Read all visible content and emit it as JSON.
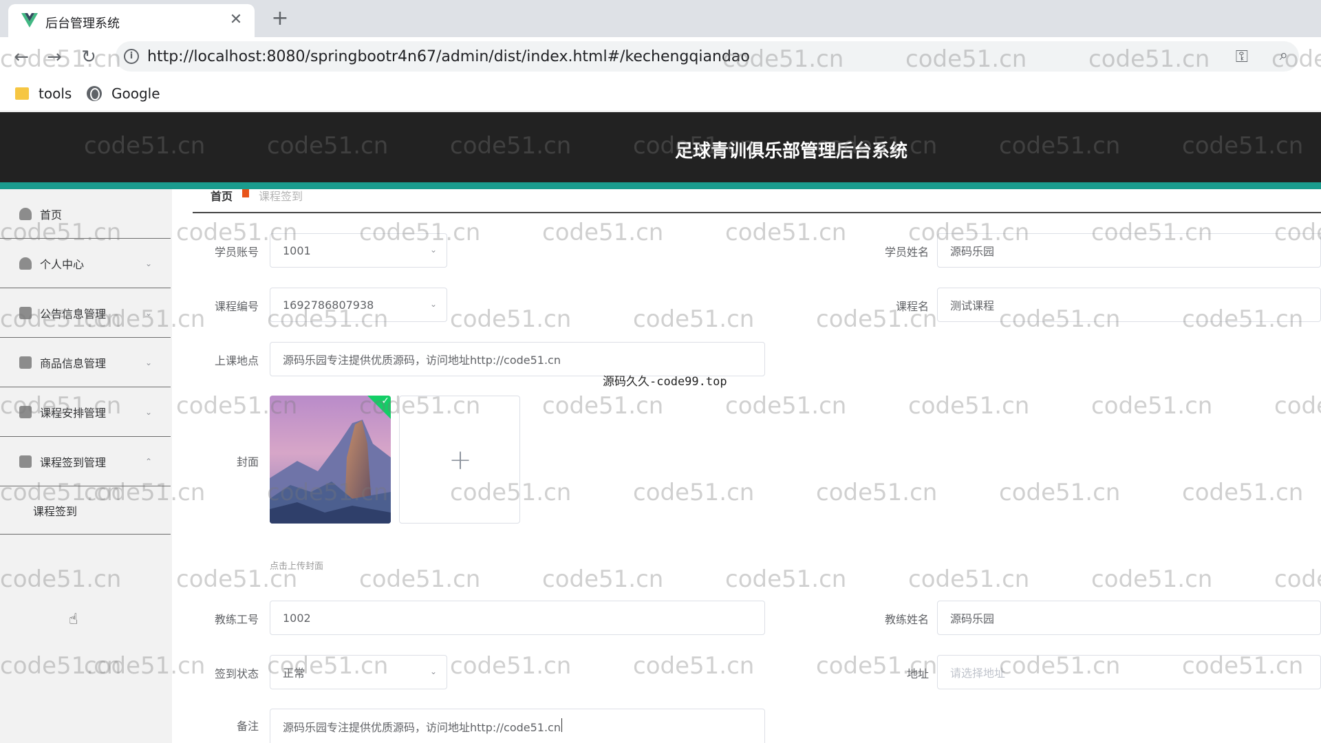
{
  "browser": {
    "tab_title": "后台管理系统",
    "url": "http://localhost:8080/springbootr4n67/admin/dist/index.html#/kechengqiandao",
    "bookmarks": [
      "tools",
      "Google"
    ]
  },
  "app": {
    "title": "足球青训俱乐部管理后台系统"
  },
  "sidebar": {
    "items": [
      {
        "label": "首页"
      },
      {
        "label": "个人中心"
      },
      {
        "label": "公告信息管理"
      },
      {
        "label": "商品信息管理"
      },
      {
        "label": "课程安排管理"
      },
      {
        "label": "课程签到管理"
      }
    ],
    "submenu": [
      {
        "label": "课程签到"
      }
    ]
  },
  "breadcrumb": {
    "home": "首页",
    "current": "课程签到"
  },
  "form": {
    "student_account": {
      "label": "学员账号",
      "value": "1001"
    },
    "student_name": {
      "label": "学员姓名",
      "value": "源码乐园"
    },
    "course_no": {
      "label": "课程编号",
      "value": "1692786807938"
    },
    "course_name": {
      "label": "课程名",
      "value": "测试课程"
    },
    "location": {
      "label": "上课地点",
      "value": "源码乐园专注提供优质源码，访问地址http://code51.cn"
    },
    "cover": {
      "label": "封面",
      "tip": "点击上传封面"
    },
    "coach_id": {
      "label": "教练工号",
      "value": "1002"
    },
    "coach_name": {
      "label": "教练姓名",
      "value": "源码乐园"
    },
    "checkin_status": {
      "label": "签到状态",
      "value": "正常"
    },
    "address": {
      "label": "地址",
      "placeholder": "请选择地址"
    },
    "remark": {
      "label": "备注",
      "value": "源码乐园专注提供优质源码，访问地址http://code51.cn"
    }
  },
  "overlay_text": "源码久久-code99.top",
  "watermark": "code51.cn",
  "colors": {
    "header_bg": "#222222",
    "accent": "#1a9c8e",
    "breadcrumb_sep": "#e8541a",
    "success": "#13ce66"
  }
}
